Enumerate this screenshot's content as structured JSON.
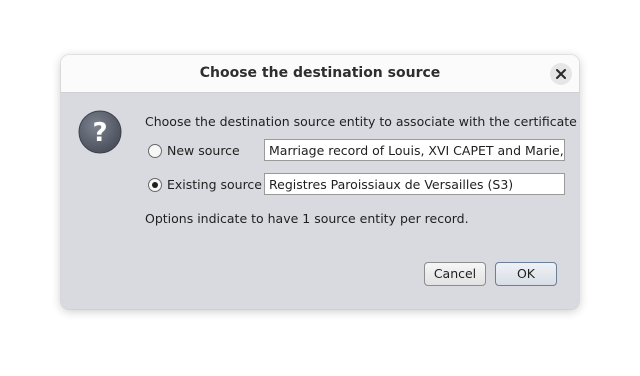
{
  "dialog": {
    "title": "Choose the destination source",
    "prompt": "Choose the destination source entity to associate with the certificate",
    "options": [
      {
        "label": "New source",
        "value": "Marriage record of Louis, XVI CAPET and Marie, Antoi",
        "selected": false
      },
      {
        "label": "Existing source",
        "value": "Registres Paroissiaux de Versailles (S3)",
        "selected": true
      }
    ],
    "note": "Options indicate to have 1 source entity per record.",
    "buttons": {
      "cancel": "Cancel",
      "ok": "OK"
    },
    "icons": {
      "close": "close-icon",
      "question": "question-icon"
    }
  }
}
